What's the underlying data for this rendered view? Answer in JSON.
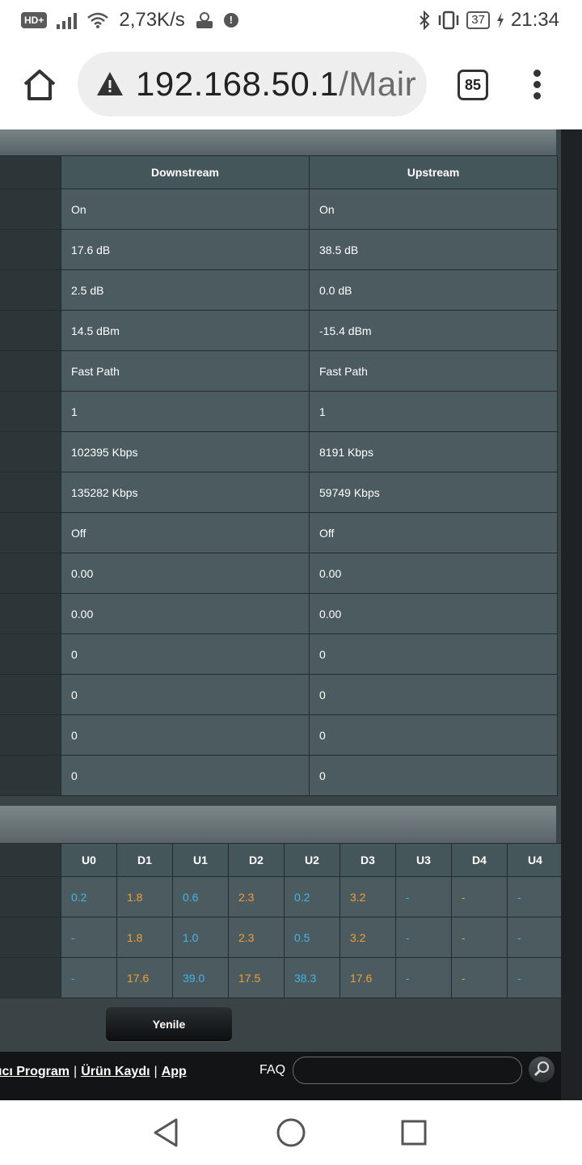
{
  "status_bar": {
    "hd_label": "HD+",
    "net_speed": "2,73K/s",
    "battery": "37",
    "time": "21:34"
  },
  "browser": {
    "url_host": "192.168.50.1",
    "url_path": "/Mair",
    "tab_count": "85"
  },
  "stats_table": {
    "headers": [
      "Downstream",
      "Upstream"
    ],
    "rows": [
      [
        "On",
        "On"
      ],
      [
        "17.6 dB",
        "38.5 dB"
      ],
      [
        "2.5 dB",
        "0.0 dB"
      ],
      [
        "14.5 dBm",
        "-15.4 dBm"
      ],
      [
        "Fast Path",
        "Fast Path"
      ],
      [
        "1",
        "1"
      ],
      [
        "102395 Kbps",
        "8191 Kbps"
      ],
      [
        "135282 Kbps",
        "59749 Kbps"
      ],
      [
        "Off",
        "Off"
      ],
      [
        "0.00",
        "0.00"
      ],
      [
        "0.00",
        "0.00"
      ],
      [
        "0",
        "0"
      ],
      [
        "0",
        "0"
      ],
      [
        "0",
        "0"
      ],
      [
        "0",
        "0"
      ]
    ]
  },
  "band_table": {
    "headers": [
      "U0",
      "D1",
      "U1",
      "D2",
      "U2",
      "D3",
      "U3",
      "D4",
      "U4"
    ],
    "colors": [
      "blue",
      "orange",
      "blue",
      "orange",
      "blue",
      "orange",
      "blue",
      "orange",
      "blue"
    ],
    "rows": [
      [
        "0.2",
        "1.8",
        "0.6",
        "2.3",
        "0.2",
        "3.2",
        "-",
        "-",
        "-"
      ],
      [
        "-",
        "1.8",
        "1.0",
        "2.3",
        "0.5",
        "3.2",
        "-",
        "-",
        "-"
      ],
      [
        "-",
        "17.6",
        "39.0",
        "17.5",
        "38.3",
        "17.6",
        "-",
        "-",
        "-"
      ]
    ],
    "accent_blue": "#3fb6ea",
    "accent_orange": "#f0a030"
  },
  "refresh_button": "Yenile",
  "footer": {
    "link1": "ıcı Program",
    "link2": "Ürün Kaydı",
    "link3": "App",
    "faq": "FAQ"
  }
}
